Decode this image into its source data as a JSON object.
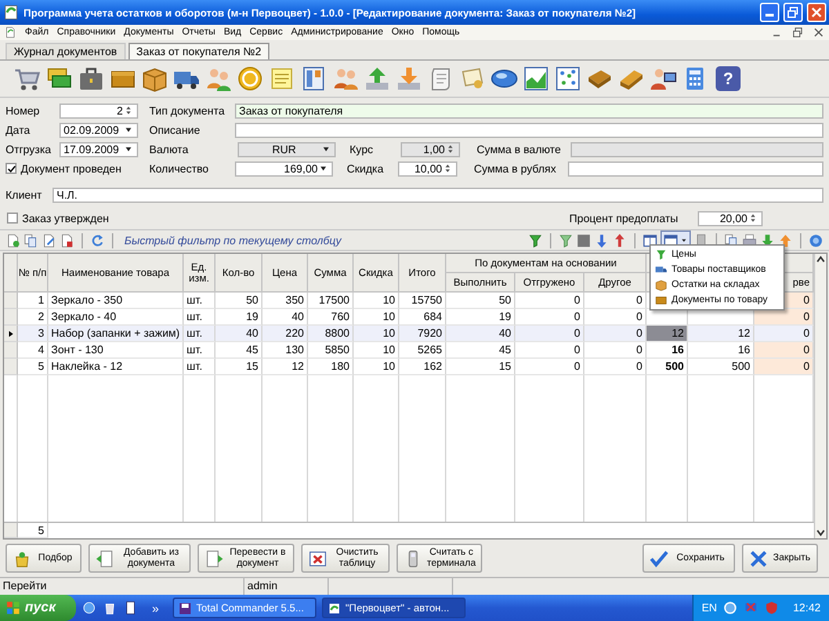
{
  "window": {
    "title": "Программа учета остатков и оборотов (м-н Первоцвет) - 1.0.0 - [Редактирование документа: Заказ от покупателя №2]"
  },
  "menu": [
    "Файл",
    "Справочники",
    "Документы",
    "Отчеты",
    "Вид",
    "Сервис",
    "Администрирование",
    "Окно",
    "Помощь"
  ],
  "doc_tabs": [
    {
      "label": "Журнал документов",
      "selected": false
    },
    {
      "label": "Заказ от покупателя №2",
      "selected": true
    }
  ],
  "toolbar": {
    "help_glyph": "?"
  },
  "form": {
    "number": {
      "label": "Номер",
      "value": "2"
    },
    "doc_type": {
      "label": "Тип документа",
      "value": "Заказ от покупателя"
    },
    "date": {
      "label": "Дата",
      "value": "02.09.2009"
    },
    "description": {
      "label": "Описание"
    },
    "shipment": {
      "label": "Отгрузка",
      "value": "17.09.2009"
    },
    "currency": {
      "label": "Валюта",
      "value": "RUR"
    },
    "rate": {
      "label": "Курс",
      "value": "1,00"
    },
    "sum_currency": {
      "label": "Сумма в валюте"
    },
    "posted": {
      "label": "Документ проведен",
      "checked": true
    },
    "quantity": {
      "label": "Количество",
      "value": "169,00"
    },
    "discount": {
      "label": "Скидка",
      "value": "10,00"
    },
    "sum_rub": {
      "label": "Сумма в рублях"
    },
    "client": {
      "label": "Клиент",
      "value": "Ч.Л."
    },
    "approved": {
      "label": "Заказ утвержден",
      "checked": false
    },
    "prepayment": {
      "label": "Процент предоплаты",
      "value": "20,00"
    }
  },
  "grid_toolbar": {
    "filter_label": "Быстрый фильтр по текущему столбцу"
  },
  "table": {
    "columns": [
      "№ п/п",
      "Наименование товара",
      "Ед. изм.",
      "Кол-во",
      "Цена",
      "Сумма",
      "Скидка",
      "Итого",
      "Выполнить",
      "Отгружено",
      "Другое",
      null,
      null,
      "рве"
    ],
    "group_header": "По документам на основании",
    "rows": [
      {
        "selected": false,
        "cells": [
          "1",
          "Зеркало - 350",
          "шт.",
          "50",
          "350",
          "17500",
          "10",
          "15750",
          "50",
          "0",
          "0",
          null,
          null,
          "0"
        ]
      },
      {
        "selected": false,
        "cells": [
          "2",
          "Зеркало - 40",
          "шт.",
          "19",
          "40",
          "760",
          "10",
          "684",
          "19",
          "0",
          "0",
          null,
          null,
          "0"
        ]
      },
      {
        "selected": true,
        "bold_cell": false,
        "cells": [
          "3",
          "Набор (запанки + зажим)",
          "шт.",
          "40",
          "220",
          "8800",
          "10",
          "7920",
          "40",
          "0",
          "0",
          "12",
          "12",
          "0"
        ]
      },
      {
        "selected": false,
        "bold_cell": true,
        "cells": [
          "4",
          "Зонт - 130",
          "шт.",
          "45",
          "130",
          "5850",
          "10",
          "5265",
          "45",
          "0",
          "0",
          "16",
          "16",
          "0"
        ]
      },
      {
        "selected": false,
        "bold_cell": true,
        "cells": [
          "5",
          "Наклейка - 12",
          "шт.",
          "15",
          "12",
          "180",
          "10",
          "162",
          "15",
          "0",
          "0",
          "500",
          "500",
          "0"
        ]
      }
    ],
    "footer_count": "5"
  },
  "dropdown": {
    "items": [
      "Цены",
      "Товары поставщиков",
      "Остатки на складах",
      "Документы по товару"
    ]
  },
  "buttons": [
    "Подбор",
    "Добавить из документа",
    "Перевести в документ",
    "Очистить таблицу",
    "Считать с терминала",
    "Сохранить",
    "Закрыть"
  ],
  "status_bar": [
    "Перейти",
    "admin"
  ],
  "taskbar": {
    "start": "пуск",
    "more": "»",
    "tasks": [
      {
        "label": "Total Commander 5.5...",
        "selected": false
      },
      {
        "label": "\"Первоцвет\" - автон...",
        "selected": true
      }
    ],
    "lang": "EN",
    "clock": "12:42"
  }
}
